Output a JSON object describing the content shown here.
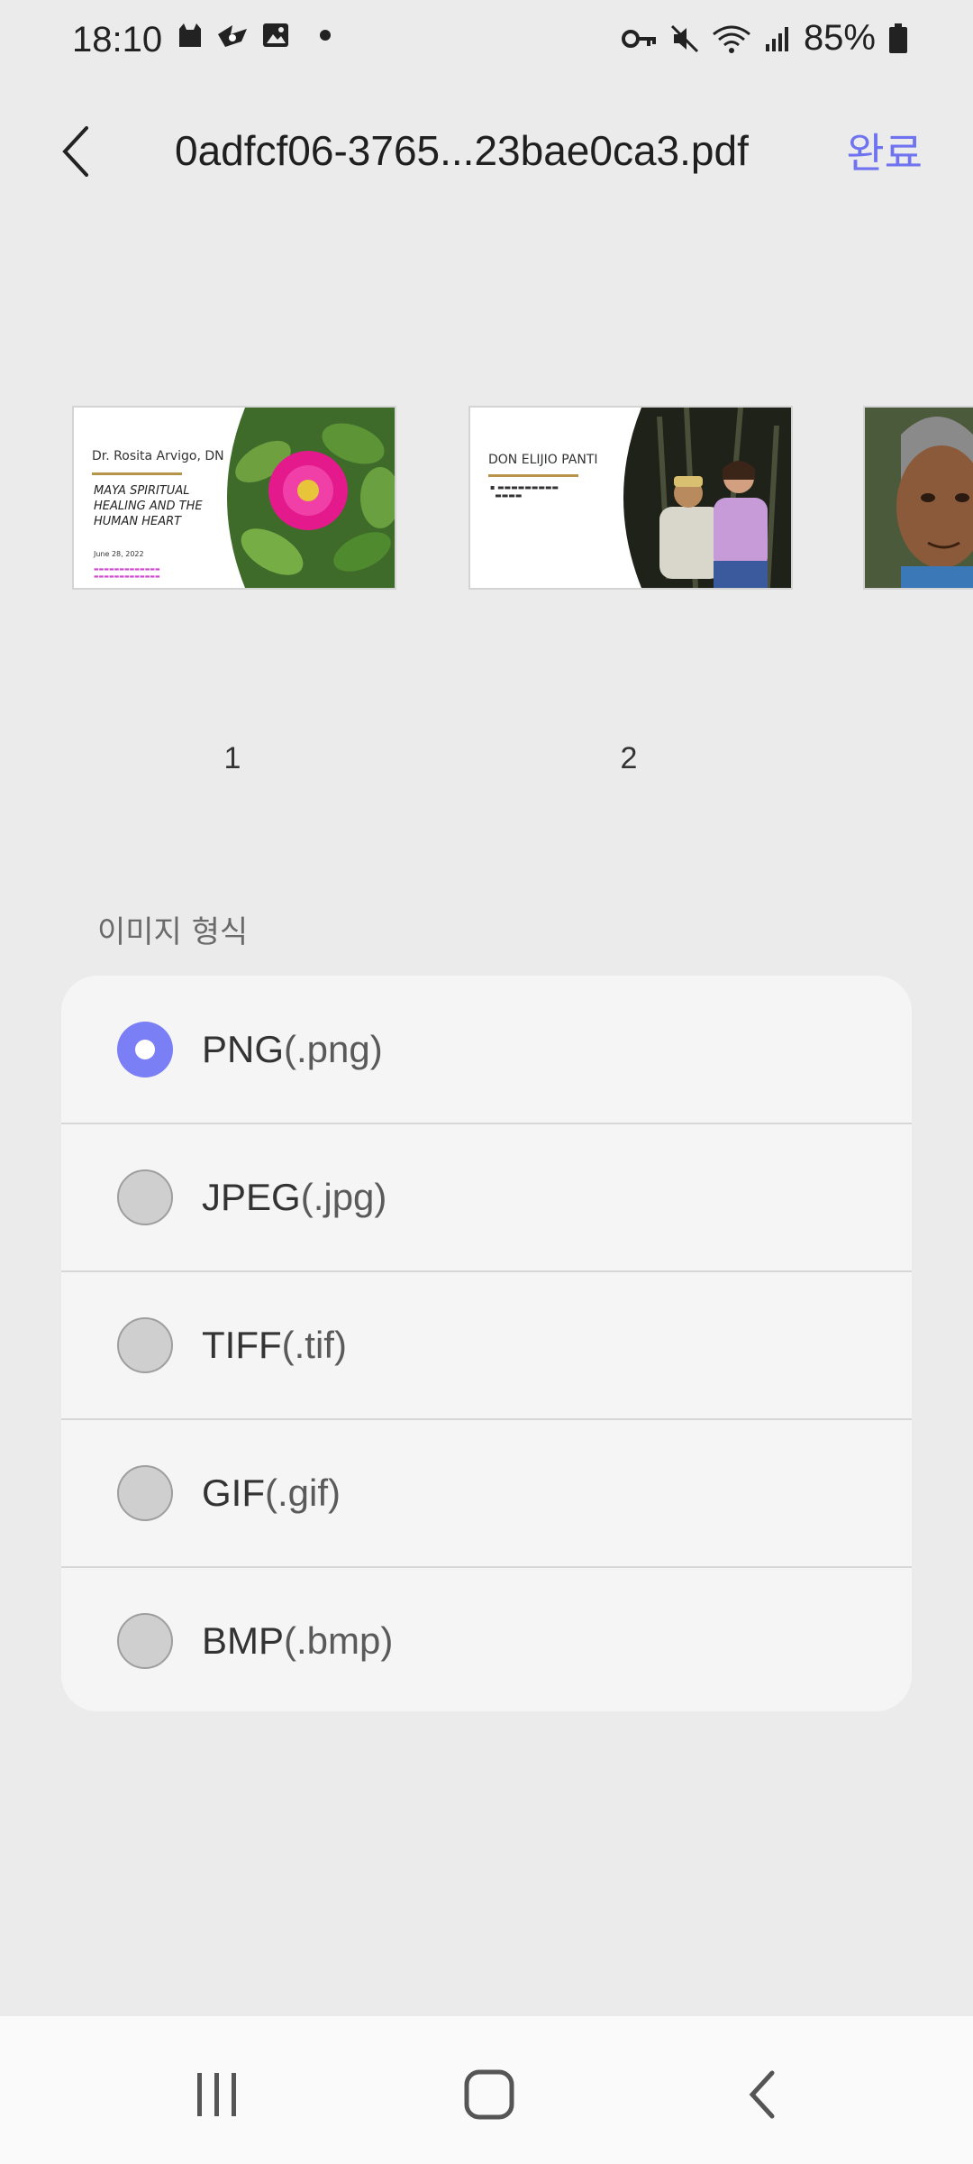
{
  "status_bar": {
    "time": "18:10",
    "battery": "85%",
    "icons_left": [
      "cat-icon",
      "bird-icon",
      "image-icon",
      "dot-icon"
    ],
    "icons_right": [
      "vpn-key-icon",
      "mute-icon",
      "wifi-icon",
      "signal-icon",
      "battery-icon"
    ]
  },
  "header": {
    "back_icon": "back-arrow-icon",
    "title": "0adfcf06-3765...23bae0ca3.pdf",
    "done_label": "완료"
  },
  "pages": [
    {
      "number": "1",
      "slide": {
        "title": "Dr. Rosita Arvigo, DN",
        "bullet": "MAYA SPIRITUAL HEALING AND THE HUMAN HEART",
        "date": "June 28, 2022"
      }
    },
    {
      "number": "2",
      "slide": {
        "title": "DON ELIJIO PANTI"
      }
    },
    {
      "number": ""
    }
  ],
  "image_format": {
    "section_label": "이미지 형식",
    "options": [
      {
        "name": "PNG",
        "ext": "(.png)",
        "selected": true
      },
      {
        "name": "JPEG",
        "ext": "(.jpg)",
        "selected": false
      },
      {
        "name": "TIFF",
        "ext": "(.tif)",
        "selected": false
      },
      {
        "name": "GIF",
        "ext": "(.gif)",
        "selected": false
      },
      {
        "name": "BMP",
        "ext": "(.bmp)",
        "selected": false
      }
    ]
  },
  "nav_bar": {
    "items": [
      "recents-icon",
      "home-icon",
      "back-icon"
    ]
  },
  "colors": {
    "accent": "#6f73f0",
    "radio_selected": "#7b7ff5",
    "background": "#ebebeb",
    "panel": "#f5f5f5"
  }
}
